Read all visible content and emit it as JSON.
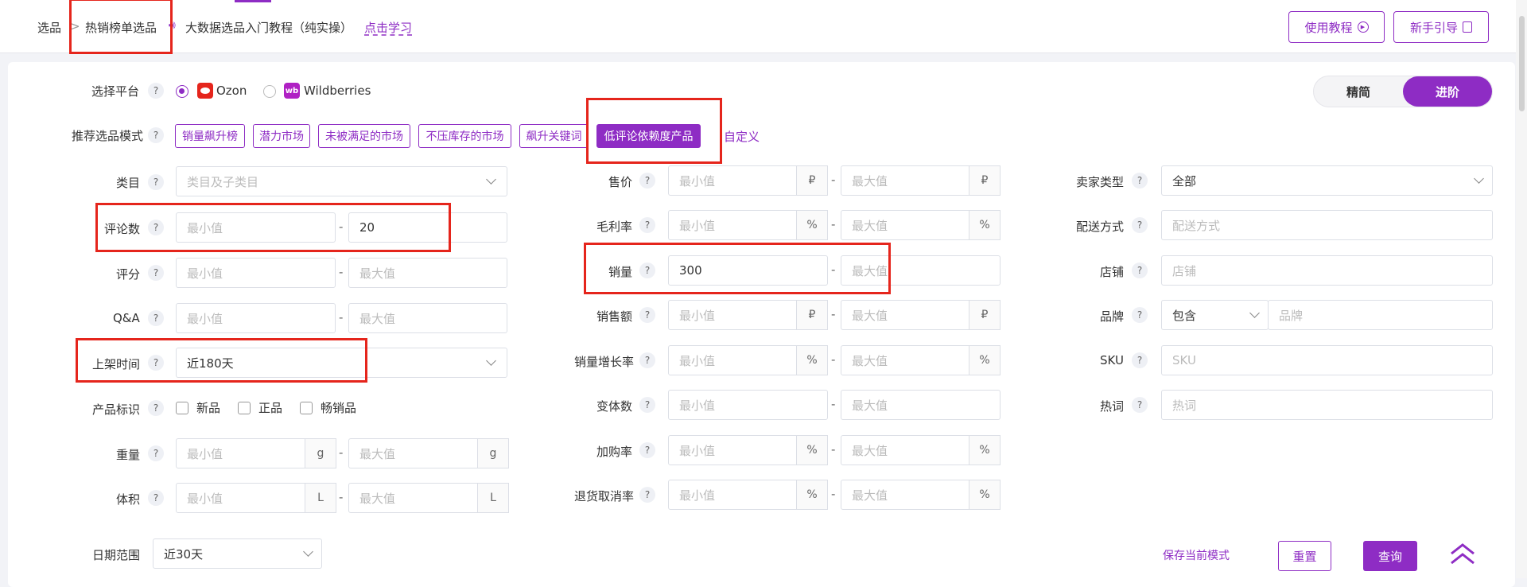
{
  "breadcrumb": {
    "root": "选品",
    "sep": ">",
    "current": "热销榜单选品"
  },
  "notice": {
    "text": "大数据选品入门教程（纯实操）",
    "link": "点击学习"
  },
  "top_buttons": {
    "tutorial": "使用教程",
    "guide": "新手引导"
  },
  "platform": {
    "label": "选择平台",
    "options": [
      "Ozon",
      "Wildberries"
    ],
    "selected": "Ozon"
  },
  "view_toggle": {
    "simple": "精简",
    "advanced": "进阶",
    "selected": "进阶"
  },
  "modes": {
    "label": "推荐选品模式",
    "items": [
      "销量飙升榜",
      "潜力市场",
      "未被满足的市场",
      "不压库存的市场",
      "飙升关键词",
      "低评论依赖度产品"
    ],
    "active": "低评论依赖度产品",
    "custom": "自定义"
  },
  "help": "?",
  "placeholders": {
    "min": "最小值",
    "max": "最大值"
  },
  "units": {
    "rub": "₽",
    "pct": "%",
    "g": "g",
    "L": "L"
  },
  "left": {
    "category": {
      "label": "类目",
      "placeholder": "类目及子类目"
    },
    "reviews": {
      "label": "评论数",
      "max": "20"
    },
    "rating": {
      "label": "评分"
    },
    "qa": {
      "label": "Q&A"
    },
    "listing_time": {
      "label": "上架时间",
      "value": "近180天"
    },
    "tags": {
      "label": "产品标识",
      "options": [
        "新品",
        "正品",
        "畅销品"
      ]
    },
    "weight": {
      "label": "重量"
    },
    "volume": {
      "label": "体积"
    }
  },
  "middle": {
    "price": {
      "label": "售价"
    },
    "margin": {
      "label": "毛利率"
    },
    "sales": {
      "label": "销量",
      "min": "300"
    },
    "revenue": {
      "label": "销售额"
    },
    "growth": {
      "label": "销量增长率"
    },
    "variants": {
      "label": "变体数"
    },
    "cart_rate": {
      "label": "加购率"
    },
    "return_rate": {
      "label": "退货取消率"
    }
  },
  "right": {
    "seller_type": {
      "label": "卖家类型",
      "value": "全部"
    },
    "shipping": {
      "label": "配送方式",
      "placeholder": "配送方式"
    },
    "store": {
      "label": "店铺",
      "placeholder": "店铺"
    },
    "brand": {
      "label": "品牌",
      "mode": "包含",
      "placeholder": "品牌"
    },
    "sku": {
      "label": "SKU",
      "placeholder": "SKU"
    },
    "hotword": {
      "label": "热词",
      "placeholder": "热词"
    }
  },
  "date_range": {
    "label": "日期范围",
    "value": "近30天"
  },
  "actions": {
    "save": "保存当前模式",
    "reset": "重置",
    "query": "查询"
  },
  "colors": {
    "accent": "#8e2cc4",
    "highlight": "#e5251c"
  }
}
